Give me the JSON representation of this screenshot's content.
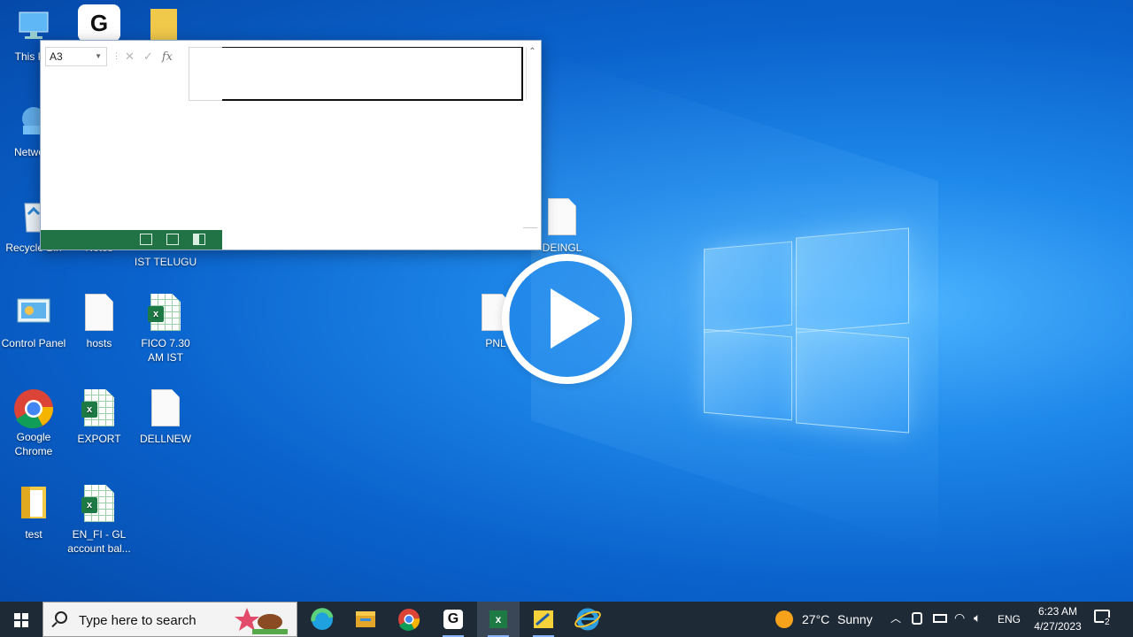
{
  "desktop": {
    "icons": [
      {
        "label": "This PC",
        "kind": "pc"
      },
      {
        "label": "Network",
        "kind": "network"
      },
      {
        "label": "Recycle Bin",
        "kind": "recycle"
      },
      {
        "label": "Control Panel",
        "kind": "control"
      },
      {
        "label": "Google Chrome",
        "kind": "chrome"
      },
      {
        "label": "test",
        "kind": "folder"
      },
      {
        "label": "Notes",
        "kind": "doc"
      },
      {
        "label": "hosts",
        "kind": "doc"
      },
      {
        "label": "EXPORT",
        "kind": "excel"
      },
      {
        "label": "EN_FI - GL account bal...",
        "kind": "excel"
      },
      {
        "label": "IST TELUGU",
        "kind": "doc"
      },
      {
        "label": "FICO 7.30 AM IST",
        "kind": "excel"
      },
      {
        "label": "DELLNEW",
        "kind": "doc"
      },
      {
        "label": "DEINGL",
        "kind": "doc"
      },
      {
        "label": "PNL",
        "kind": "doc"
      }
    ]
  },
  "excel_window": {
    "name_box": "A3",
    "fx_label": "fx"
  },
  "taskbar": {
    "search_placeholder": "Type here to search",
    "weather_temp": "27°C",
    "weather_text": "Sunny",
    "language": "ENG",
    "time": "6:23 AM",
    "date": "4/27/2023",
    "notification_count": "2"
  }
}
